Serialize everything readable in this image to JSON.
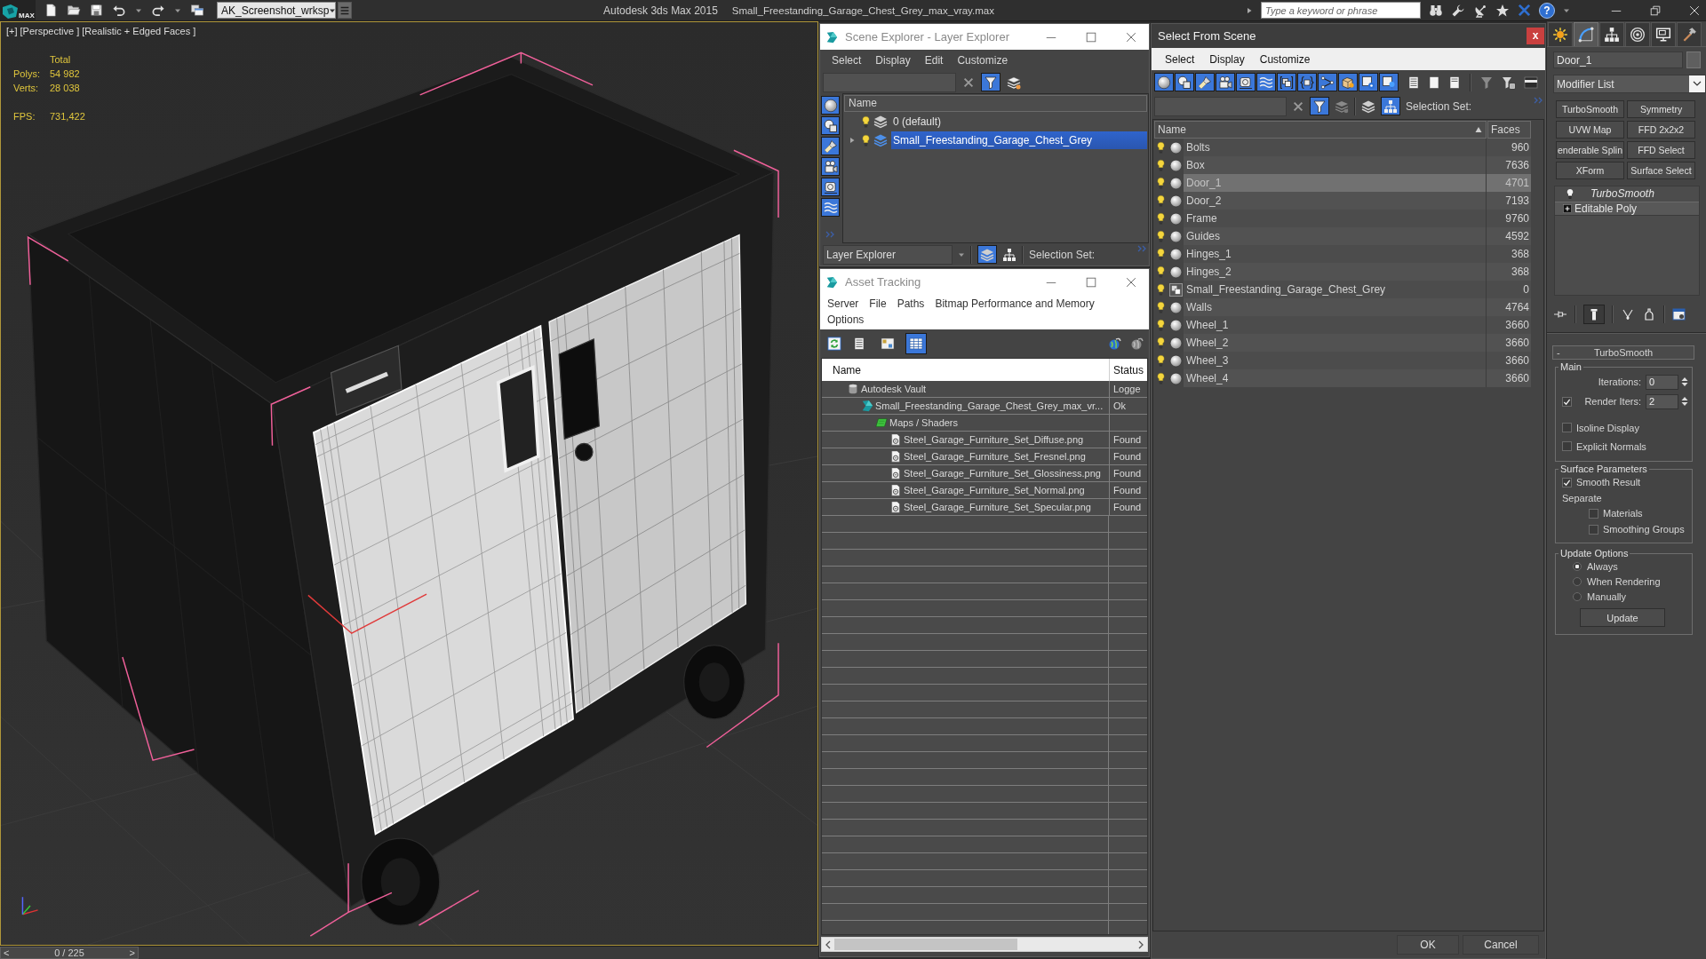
{
  "title_bar": {
    "logo_text": "MAX",
    "workspace": "AK_Screenshot_wrksp",
    "app_title": "Autodesk 3ds Max 2015",
    "file_name": "Small_Freestanding_Garage_Chest_Grey_max_vray.max",
    "search": {
      "placeholder": "Type a keyword or phrase"
    },
    "help": "?"
  },
  "viewport": {
    "labels": [
      "[+]",
      "[Perspective ]",
      "[Realistic + Edged Faces ]"
    ],
    "stats": {
      "heading": "Total",
      "rows": [
        {
          "label": "Polys:",
          "value": "54 982"
        },
        {
          "label": "Verts:",
          "value": "28 038"
        }
      ],
      "fps": {
        "label": "FPS:",
        "value": "731,422"
      }
    }
  },
  "time_slider": {
    "previous": "<",
    "frame": "0 / 225",
    "next": ">",
    "level": 0
  },
  "scene_explorer": {
    "title": "Scene Explorer - Layer Explorer",
    "menu": [
      "Select",
      "Display",
      "Edit",
      "Customize"
    ],
    "filter": {
      "on": true
    },
    "display_filters": [
      {
        "on": true
      },
      {
        "on": true
      },
      {
        "on": true
      },
      {
        "on": true
      },
      {
        "on": true
      },
      {
        "on": true
      }
    ],
    "tree": {
      "column": "Name",
      "items": [
        {
          "label": "0 (default)",
          "current": false,
          "selected": false
        },
        {
          "label": "Small_Freestanding_Garage_Chest_Grey",
          "current": true,
          "selected": true,
          "expanded": false
        }
      ]
    },
    "explorer_mode": "Layer Explorer",
    "layer_view": {
      "on": true
    },
    "selection_set_label": "Selection Set:"
  },
  "asset_tracking": {
    "title": "Asset Tracking",
    "menu": [
      [
        "Server",
        "File",
        "Paths",
        "Bitmap Performance and Memory"
      ],
      [
        "Options"
      ]
    ],
    "view_modes": [
      {
        "selected": false
      },
      {
        "selected": false
      },
      {
        "selected": true
      }
    ],
    "columns": [
      "Name",
      "Status"
    ],
    "rows": [
      {
        "kind": "vault",
        "name": "Autodesk Vault",
        "status": "Logge",
        "children": [
          {
            "kind": "scene_file",
            "name": "Small_Freestanding_Garage_Chest_Grey_max_vr...",
            "status": "Ok",
            "children": [
              {
                "kind": "group",
                "name": "Maps / Shaders",
                "children": [
                  {
                    "kind": "bitmap",
                    "name": "Steel_Garage_Furniture_Set_Diffuse.png",
                    "status": "Found"
                  },
                  {
                    "kind": "bitmap",
                    "name": "Steel_Garage_Furniture_Set_Fresnel.png",
                    "status": "Found"
                  },
                  {
                    "kind": "bitmap",
                    "name": "Steel_Garage_Furniture_Set_Glossiness.png",
                    "status": "Found"
                  },
                  {
                    "kind": "bitmap",
                    "name": "Steel_Garage_Furniture_Set_Normal.png",
                    "status": "Found"
                  },
                  {
                    "kind": "bitmap",
                    "name": "Steel_Garage_Furniture_Set_Specular.png",
                    "status": "Found"
                  }
                ]
              }
            ]
          }
        ]
      }
    ]
  },
  "select_from_scene": {
    "title": "Select From Scene",
    "close": "x",
    "menu": [
      "Select",
      "Display",
      "Customize"
    ],
    "display_filters": [
      {
        "on": true
      },
      {
        "on": true
      },
      {
        "on": true
      },
      {
        "on": true
      },
      {
        "on": true
      },
      {
        "on": true
      },
      {
        "on": true
      },
      {
        "on": true
      },
      {
        "on": true
      },
      {
        "on": true
      },
      {
        "on": true
      },
      {
        "on": true
      }
    ],
    "search_filter": {
      "on": true
    },
    "hierarchy_view": {
      "on": true
    },
    "selection_set_label": "Selection Set:",
    "columns": [
      {
        "label": "Name",
        "sort_ascending": true
      },
      {
        "label": "Faces"
      }
    ],
    "rows": [
      {
        "name": "Bolts",
        "faces": "960",
        "kind": "geometry",
        "selected": false
      },
      {
        "name": "Box",
        "faces": "7636",
        "kind": "geometry",
        "selected": false
      },
      {
        "name": "Door_1",
        "faces": "4701",
        "kind": "geometry",
        "selected": true
      },
      {
        "name": "Door_2",
        "faces": "7193",
        "kind": "geometry",
        "selected": false
      },
      {
        "name": "Frame",
        "faces": "9760",
        "kind": "geometry",
        "selected": false
      },
      {
        "name": "Guides",
        "faces": "4592",
        "kind": "geometry",
        "selected": false
      },
      {
        "name": "Hinges_1",
        "faces": "368",
        "kind": "geometry",
        "selected": false
      },
      {
        "name": "Hinges_2",
        "faces": "368",
        "kind": "geometry",
        "selected": false
      },
      {
        "name": "Small_Freestanding_Garage_Chest_Grey",
        "faces": "0",
        "kind": "group",
        "selected": false
      },
      {
        "name": "Walls",
        "faces": "4764",
        "kind": "geometry",
        "selected": false
      },
      {
        "name": "Wheel_1",
        "faces": "3660",
        "kind": "geometry",
        "selected": false
      },
      {
        "name": "Wheel_2",
        "faces": "3660",
        "kind": "geometry",
        "selected": false
      },
      {
        "name": "Wheel_3",
        "faces": "3660",
        "kind": "geometry",
        "selected": false
      },
      {
        "name": "Wheel_4",
        "faces": "3660",
        "kind": "geometry",
        "selected": false
      }
    ],
    "buttons": [
      "OK",
      "Cancel"
    ]
  },
  "command_panel": {
    "tabs": [
      {
        "selected": false
      },
      {
        "selected": true
      },
      {
        "selected": false
      },
      {
        "selected": false
      },
      {
        "selected": false
      },
      {
        "selected": false
      }
    ],
    "object_name": "Door_1",
    "modifier_list": "Modifier List",
    "modifier_buttons": [
      "TurboSmooth",
      "Symmetry",
      "UVW Map",
      "FFD 2x2x2",
      "enderable Splin",
      "FFD Select",
      "XForm",
      "Surface Select"
    ],
    "stack": [
      {
        "kind": "modifier",
        "label": "TurboSmooth",
        "off_in_viewport": true
      },
      {
        "kind": "base_object",
        "label": "Editable Poly",
        "expanded": false
      }
    ],
    "show_end_result": {
      "on": true
    },
    "rollout": {
      "sign": "-",
      "title": "TurboSmooth",
      "groups": [
        {
          "title": "Main",
          "controls": [
            {
              "kind": "spinner",
              "label": "Iterations:",
              "value": "0"
            },
            {
              "kind": "spinner",
              "label": "Render Iters:",
              "value": "2",
              "checked": true
            },
            {
              "kind": "checkbox",
              "label": "Isoline Display",
              "checked": false
            },
            {
              "kind": "checkbox",
              "label": "Explicit Normals",
              "checked": false
            }
          ]
        },
        {
          "title": "Surface Parameters",
          "controls": [
            {
              "kind": "checkbox",
              "label": "Smooth Result",
              "checked": true
            },
            {
              "kind": "label",
              "label": "Separate",
              "children": [
                {
                  "kind": "checkbox",
                  "label": "Materials",
                  "checked": false
                },
                {
                  "kind": "checkbox",
                  "label": "Smoothing Groups",
                  "checked": false
                }
              ]
            }
          ]
        },
        {
          "title": "Update Options",
          "controls": [
            {
              "kind": "radio",
              "label": "Always",
              "selected": true
            },
            {
              "kind": "radio",
              "label": "When Rendering",
              "selected": false
            },
            {
              "kind": "radio",
              "label": "Manually",
              "selected": false
            },
            {
              "kind": "button",
              "label": "Update"
            }
          ]
        }
      ]
    }
  }
}
